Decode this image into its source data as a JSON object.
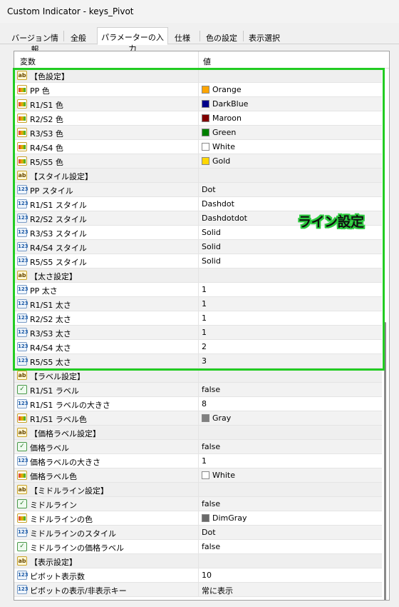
{
  "window": {
    "title": "Custom Indicator - keys_Pivot"
  },
  "tabs": [
    {
      "label": "バージョン情報",
      "active": false
    },
    {
      "label": "全般",
      "active": false
    },
    {
      "label": "パラメーターの入力",
      "active": true
    },
    {
      "label": "仕様",
      "active": false
    },
    {
      "label": "色の設定",
      "active": false
    },
    {
      "label": "表示選択",
      "active": false
    }
  ],
  "table": {
    "col_name": "変数",
    "col_value": "値",
    "rows": [
      {
        "type": "ab",
        "name": "【色設定】",
        "value": "",
        "group": true
      },
      {
        "type": "color",
        "name": "PP 色",
        "value": "Orange",
        "swatch": "#FFA500"
      },
      {
        "type": "color",
        "name": "R1/S1 色",
        "value": "DarkBlue",
        "swatch": "#00008B"
      },
      {
        "type": "color",
        "name": "R2/S2 色",
        "value": "Maroon",
        "swatch": "#800000"
      },
      {
        "type": "color",
        "name": "R3/S3 色",
        "value": "Green",
        "swatch": "#008000"
      },
      {
        "type": "color",
        "name": "R4/S4 色",
        "value": "White",
        "swatch": "#FFFFFF"
      },
      {
        "type": "color",
        "name": "R5/S5 色",
        "value": "Gold",
        "swatch": "#FFD700"
      },
      {
        "type": "ab",
        "name": "【スタイル設定】",
        "value": "",
        "group": true
      },
      {
        "type": "num",
        "name": "PP スタイル",
        "value": "Dot"
      },
      {
        "type": "num",
        "name": "R1/S1 スタイル",
        "value": "Dashdot"
      },
      {
        "type": "num",
        "name": "R2/S2 スタイル",
        "value": "Dashdotdot"
      },
      {
        "type": "num",
        "name": "R3/S3 スタイル",
        "value": "Solid"
      },
      {
        "type": "num",
        "name": "R4/S4 スタイル",
        "value": "Solid"
      },
      {
        "type": "num",
        "name": "R5/S5 スタイル",
        "value": "Solid"
      },
      {
        "type": "ab",
        "name": "【太さ設定】",
        "value": "",
        "group": true
      },
      {
        "type": "num",
        "name": "PP 太さ",
        "value": "1"
      },
      {
        "type": "num",
        "name": "R1/S1 太さ",
        "value": "1"
      },
      {
        "type": "num",
        "name": "R2/S2 太さ",
        "value": "1"
      },
      {
        "type": "num",
        "name": "R3/S3 太さ",
        "value": "1"
      },
      {
        "type": "num",
        "name": "R4/S4 太さ",
        "value": "2"
      },
      {
        "type": "num",
        "name": "R5/S5 太さ",
        "value": "3"
      },
      {
        "type": "ab",
        "name": "【ラベル設定】",
        "value": "",
        "group": true
      },
      {
        "type": "bool",
        "name": "R1/S1 ラベル",
        "value": "false"
      },
      {
        "type": "num",
        "name": "R1/S1 ラベルの大きさ",
        "value": "8"
      },
      {
        "type": "color",
        "name": "R1/S1 ラベル色",
        "value": "Gray",
        "swatch": "#808080"
      },
      {
        "type": "ab",
        "name": "【価格ラベル設定】",
        "value": "",
        "group": true
      },
      {
        "type": "bool",
        "name": "価格ラベル",
        "value": "false"
      },
      {
        "type": "num",
        "name": "価格ラベルの大きさ",
        "value": "1"
      },
      {
        "type": "color",
        "name": "価格ラベル色",
        "value": "White",
        "swatch": "#FFFFFF"
      },
      {
        "type": "ab",
        "name": "【ミドルライン設定】",
        "value": "",
        "group": true
      },
      {
        "type": "bool",
        "name": "ミドルライン",
        "value": "false"
      },
      {
        "type": "color",
        "name": "ミドルラインの色",
        "value": "DimGray",
        "swatch": "#696969"
      },
      {
        "type": "num",
        "name": "ミドルラインのスタイル",
        "value": "Dot"
      },
      {
        "type": "bool",
        "name": "ミドルラインの価格ラベル",
        "value": "false"
      },
      {
        "type": "ab",
        "name": "【表示設定】",
        "value": "",
        "group": true
      },
      {
        "type": "num",
        "name": "ピボット表示数",
        "value": "10"
      },
      {
        "type": "num",
        "name": "ピボットの表示/非表示キー",
        "value": "常に表示"
      }
    ]
  },
  "annotation": {
    "label": "ライン設定",
    "color": "#22CC22"
  },
  "icons": {
    "ab": "ab-string-icon",
    "color": "color-param-icon",
    "num": "numeric-123-icon",
    "bool": "boolean-toggle-icon"
  }
}
